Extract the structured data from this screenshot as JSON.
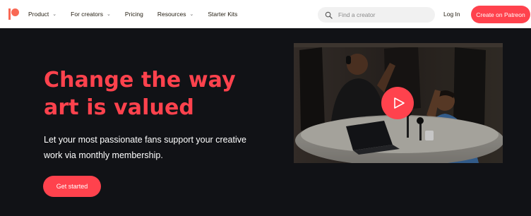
{
  "header": {
    "brand": "Patreon",
    "nav": [
      {
        "label": "Product",
        "dropdown": true
      },
      {
        "label": "For creators",
        "dropdown": true
      },
      {
        "label": "Pricing",
        "dropdown": false
      },
      {
        "label": "Resources",
        "dropdown": true
      },
      {
        "label": "Starter Kits",
        "dropdown": false
      }
    ],
    "search": {
      "placeholder": "Find a creator",
      "value": ""
    },
    "login_label": "Log In",
    "create_label": "Create on Patreon"
  },
  "hero": {
    "title_line1": "Change the way",
    "title_line2": "art is valued",
    "subtitle_line1": "Let your most passionate fans support your creative",
    "subtitle_line2": "work via monthly membership.",
    "cta_label": "Get started"
  },
  "video": {
    "play_icon": "play-icon"
  },
  "colors": {
    "brand": "#ff424d",
    "hero_background": "#111216",
    "text_dark": "#241e12"
  }
}
